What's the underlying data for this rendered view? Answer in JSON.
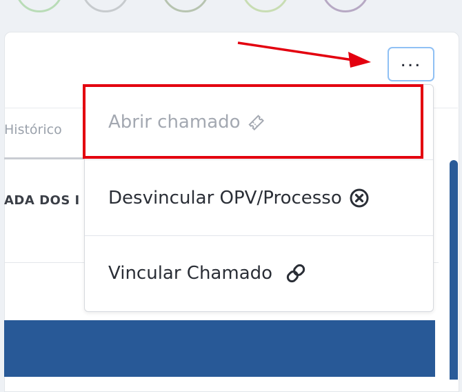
{
  "top_circles": [
    {
      "color": "#b9dcb7"
    },
    {
      "color": "#c7cbce"
    },
    {
      "color": "#b7c4b0"
    },
    {
      "color": "#c8ddb3"
    },
    {
      "color": "#b7a9c4"
    }
  ],
  "header": {
    "more_button_label": "...",
    "active_tab": "Histórico"
  },
  "content": {
    "section_label_fragment": "ADA DOS I"
  },
  "dropdown": {
    "items": [
      {
        "label": "Abrir chamado",
        "icon": "ticket-icon",
        "disabled": true
      },
      {
        "label": "Desvincular OPV/Processo",
        "icon": "circle-x-icon",
        "disabled": false
      },
      {
        "label": "Vincular Chamado",
        "icon": "link-icon",
        "disabled": false
      }
    ]
  },
  "annotations": {
    "highlight_color": "#e3000f",
    "arrow_color": "#e3000f"
  },
  "colors": {
    "accent_blue": "#285997",
    "focus_border": "#8fc0f4"
  }
}
